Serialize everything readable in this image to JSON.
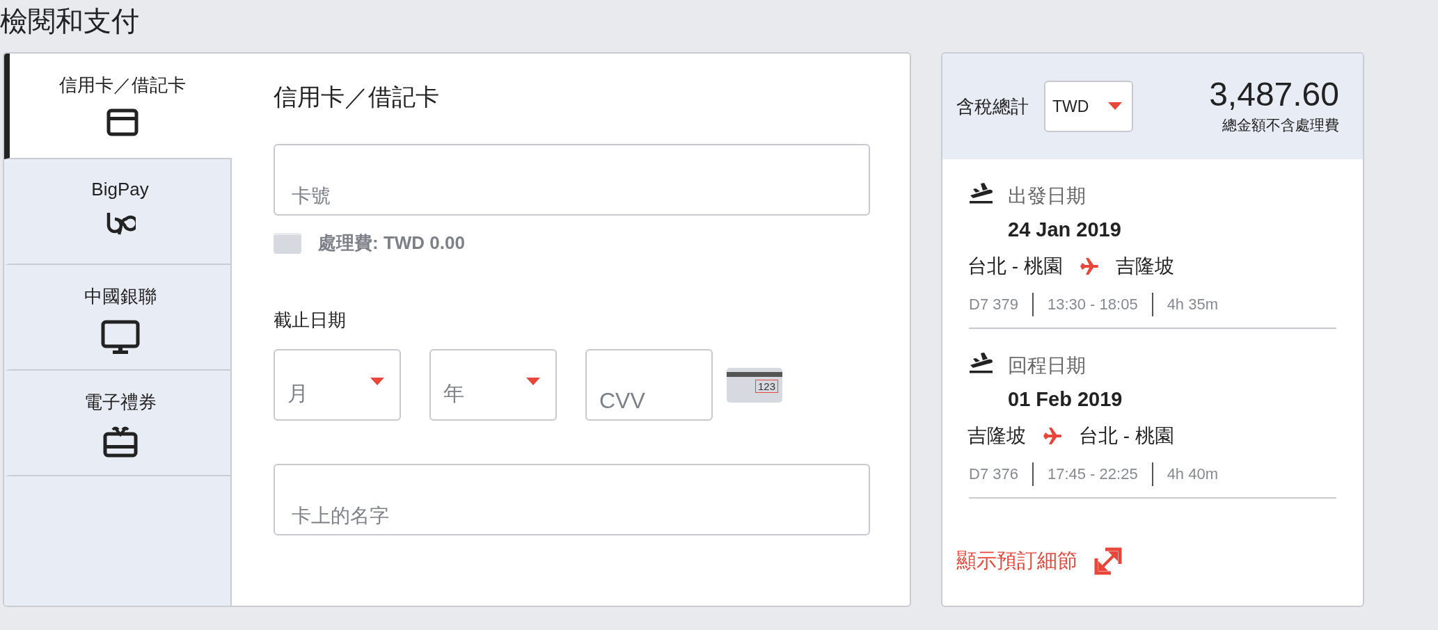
{
  "page_title": "檢閱和支付",
  "payment_methods": [
    {
      "label": "信用卡／借記卡",
      "kind": "card",
      "selected": true
    },
    {
      "label": "BigPay",
      "kind": "bigpay",
      "selected": false
    },
    {
      "label": "中國銀聯",
      "kind": "monitor",
      "selected": false
    },
    {
      "label": "電子禮券",
      "kind": "gift",
      "selected": false
    }
  ],
  "form": {
    "heading": "信用卡／借記卡",
    "card_number": {
      "placeholder": "卡號"
    },
    "fee": "處理費: TWD 0.00",
    "expiry_label": "截止日期",
    "month": {
      "label": "月"
    },
    "year": {
      "label": "年"
    },
    "cvv": {
      "placeholder": "CVV"
    },
    "cvv_hint": "123",
    "name": {
      "placeholder": "卡上的名字"
    }
  },
  "summary": {
    "total_label": "含稅總計",
    "currency": "TWD",
    "amount": "3,487.60",
    "note": "總金額不含處理費",
    "flights": [
      {
        "label": "出發日期",
        "date": "24 Jan 2019",
        "from": "台北 - 桃園",
        "to": "吉隆坡",
        "flight_no": "D7 379",
        "time": "13:30 - 18:05",
        "duration": "4h 35m"
      },
      {
        "label": "回程日期",
        "date": "01 Feb 2019",
        "from": "吉隆坡",
        "to": "台北 - 桃園",
        "flight_no": "D7 376",
        "time": "17:45 - 22:25",
        "duration": "4h 40m"
      }
    ],
    "details_link": "顯示預訂細節"
  }
}
